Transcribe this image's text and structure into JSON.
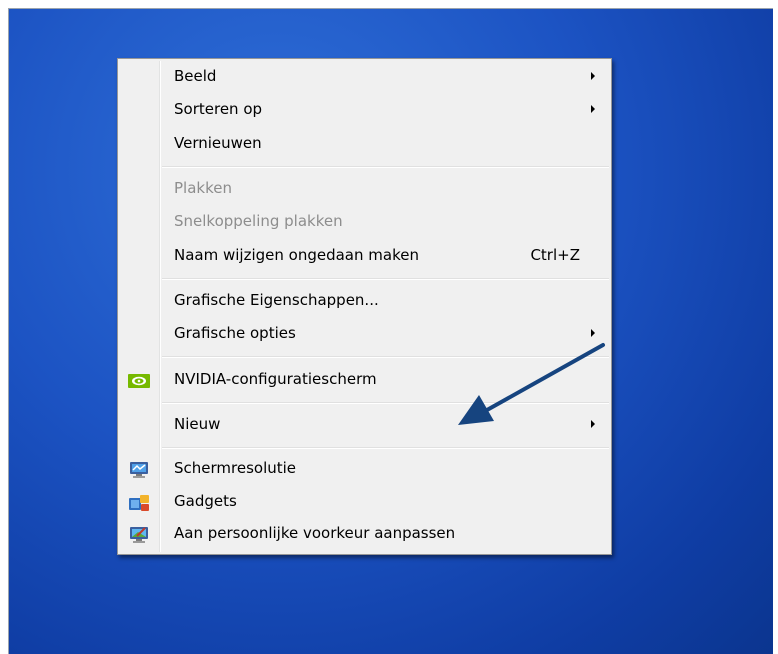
{
  "menu": {
    "groups": [
      {
        "items": [
          {
            "label": "Beeld",
            "submenu": true
          },
          {
            "label": "Sorteren op",
            "submenu": true
          },
          {
            "label": "Vernieuwen"
          }
        ]
      },
      {
        "items": [
          {
            "label": "Plakken",
            "disabled": true
          },
          {
            "label": "Snelkoppeling plakken",
            "disabled": true
          },
          {
            "label": "Naam wijzigen ongedaan maken",
            "shortcut": "Ctrl+Z"
          }
        ]
      },
      {
        "items": [
          {
            "label": "Grafische Eigenschappen..."
          },
          {
            "label": "Grafische opties",
            "submenu": true
          }
        ]
      },
      {
        "items": [
          {
            "label": "NVIDIA-configuratiescherm",
            "icon": "nvidia-icon"
          }
        ]
      },
      {
        "items": [
          {
            "label": "Nieuw",
            "submenu": true
          }
        ]
      },
      {
        "items": [
          {
            "label": "Schermresolutie",
            "icon": "display-settings-icon"
          },
          {
            "label": "Gadgets",
            "icon": "gadgets-icon"
          },
          {
            "label": "Aan persoonlijke voorkeur aanpassen",
            "icon": "personalize-icon"
          }
        ]
      }
    ]
  },
  "colors": {
    "desktop": "#1c53c3",
    "menu_bg": "#f0f0f0",
    "disabled_text": "#8d8d8d",
    "annotation_arrow": "#16447f"
  }
}
